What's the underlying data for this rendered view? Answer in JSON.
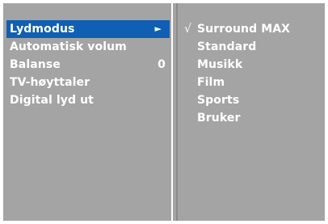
{
  "left_menu": {
    "items": [
      {
        "label": "Lydmodus",
        "arrow": "►",
        "value": ""
      },
      {
        "label": "Automatisk volum",
        "arrow": "",
        "value": ""
      },
      {
        "label": "Balanse",
        "arrow": "",
        "value": "0"
      },
      {
        "label": "TV-høyttaler",
        "arrow": "",
        "value": ""
      },
      {
        "label": "Digital lyd ut",
        "arrow": "",
        "value": ""
      }
    ],
    "selected_index": 0
  },
  "right_menu": {
    "check_mark": "√",
    "items": [
      {
        "label": "Surround MAX",
        "checked": true
      },
      {
        "label": "Standard",
        "checked": false
      },
      {
        "label": "Musikk",
        "checked": false
      },
      {
        "label": "Film",
        "checked": false
      },
      {
        "label": "Sports",
        "checked": false
      },
      {
        "label": "Bruker",
        "checked": false
      }
    ]
  },
  "colors": {
    "background": "#a4a4a4",
    "highlight": "#0f5fb4",
    "text": "#ffffff"
  }
}
